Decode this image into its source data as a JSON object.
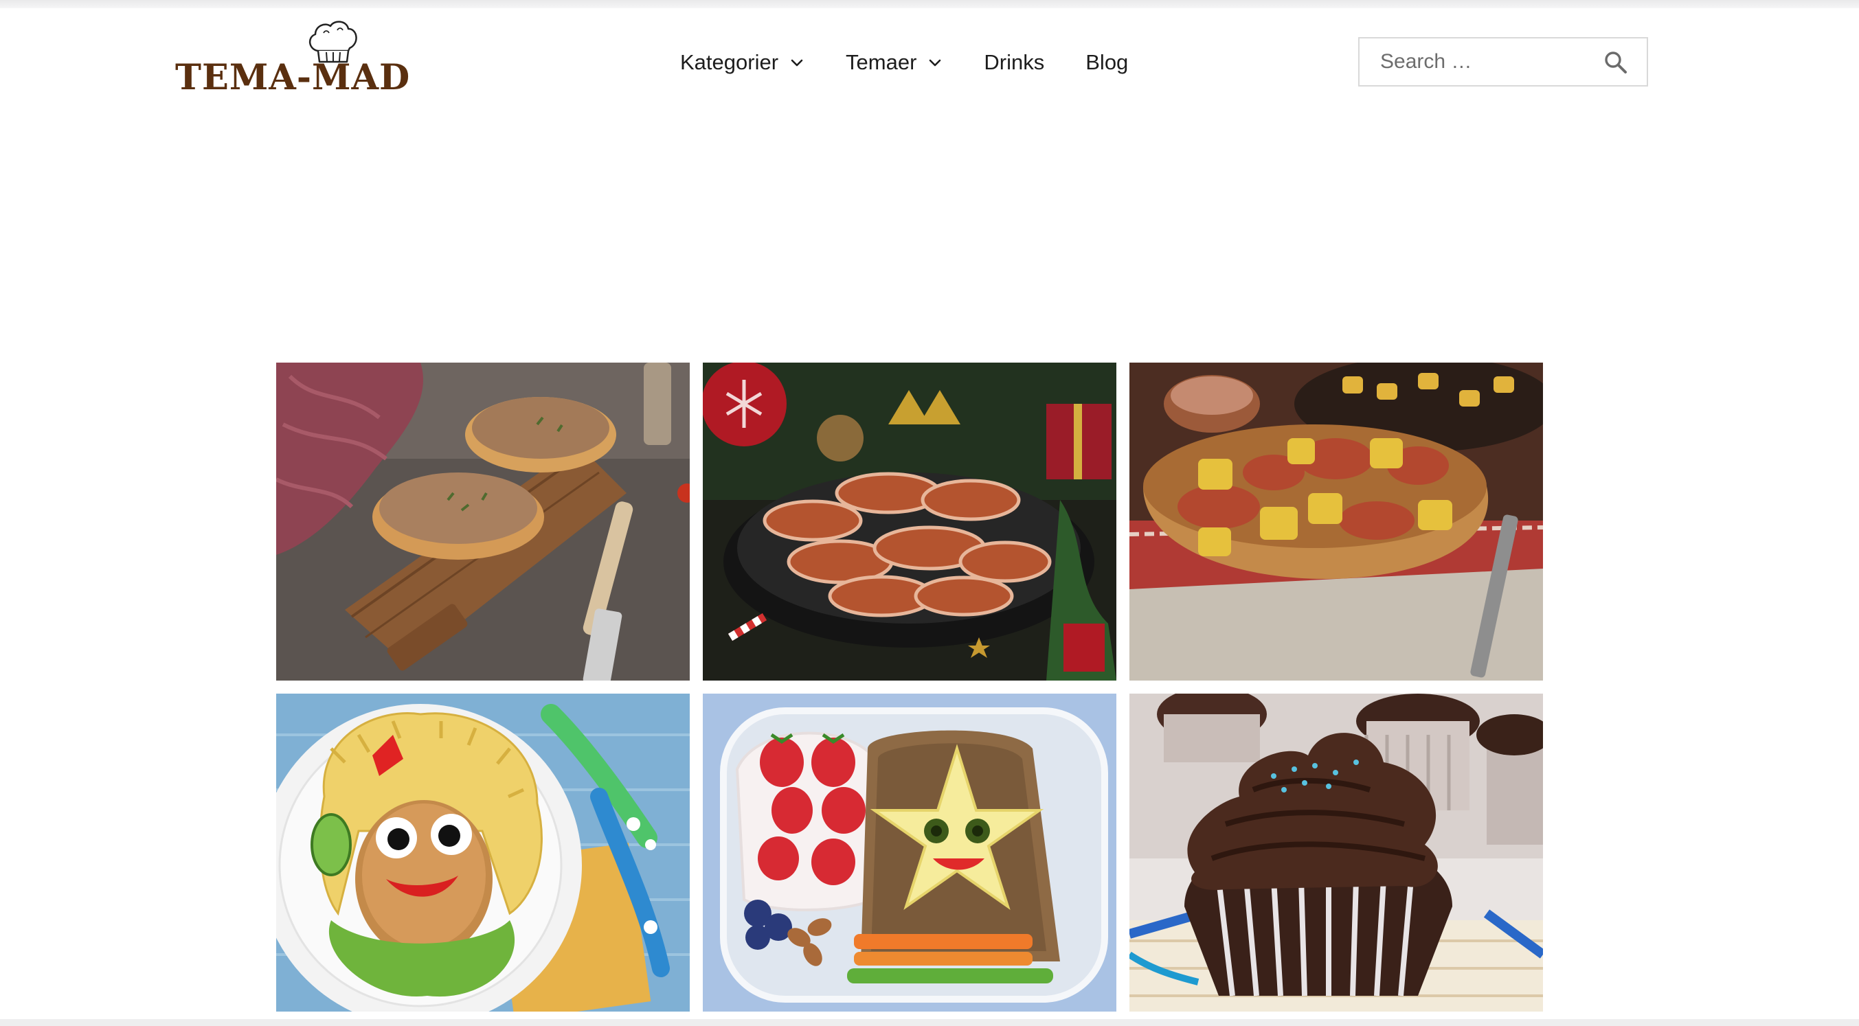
{
  "header": {
    "logo_text": "TEMA-MAD",
    "nav": [
      {
        "label": "Kategorier",
        "has_dropdown": true
      },
      {
        "label": "Temaer",
        "has_dropdown": true
      },
      {
        "label": "Drinks",
        "has_dropdown": false
      },
      {
        "label": "Blog",
        "has_dropdown": false
      }
    ],
    "search": {
      "placeholder": "Search …",
      "value": "",
      "icon": "magnifier-icon"
    }
  },
  "colors": {
    "brand": "#5a2f0f",
    "nav_text": "#1d1d1d",
    "search_border": "#d9d9d9"
  },
  "recipes": [
    {
      "image": "liver-pate-on-bread-photo"
    },
    {
      "image": "bacon-wrapped-sausages-christmas-photo"
    },
    {
      "image": "sausages-and-potatoes-bowl-photo"
    },
    {
      "image": "kids-pasta-face-plate-photo"
    },
    {
      "image": "star-cheese-lunchbox-photo"
    },
    {
      "image": "chocolate-cupcake-photo"
    }
  ]
}
